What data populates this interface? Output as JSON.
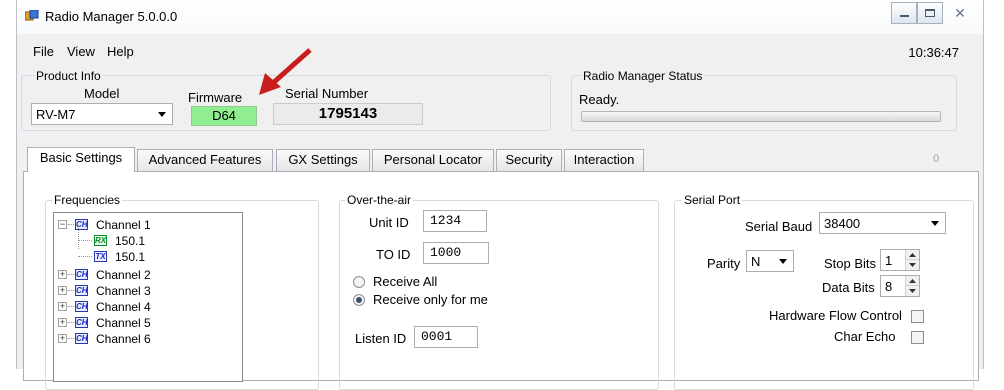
{
  "app": {
    "title": "Radio Manager  5.0.0.0"
  },
  "menu": {
    "file": "File",
    "view": "View",
    "help": "Help"
  },
  "clock": "10:36:47",
  "product_info": {
    "label": "Product Info",
    "model_label": "Model",
    "model_value": "RV-M7",
    "firmware_label": "Firmware",
    "firmware_value": "D64",
    "serial_label": "Serial Number",
    "serial_value": "1795143"
  },
  "status": {
    "label": "Radio Manager Status",
    "text": "Ready.",
    "progress": 0
  },
  "tabs": [
    "Basic Settings",
    "Advanced Features",
    "GX Settings",
    "Personal Locator",
    "Security",
    "Interaction"
  ],
  "tab_counter": "0",
  "frequencies": {
    "label": "Frequencies",
    "channels": [
      {
        "label": "Channel 1",
        "expanded": true,
        "rx": "150.1",
        "tx": "150.1"
      },
      {
        "label": "Channel 2"
      },
      {
        "label": "Channel 3"
      },
      {
        "label": "Channel 4"
      },
      {
        "label": "Channel 5"
      },
      {
        "label": "Channel 6"
      }
    ],
    "icons": {
      "ch": "CH",
      "rx": "RX",
      "tx": "TX"
    }
  },
  "ota": {
    "label": "Over-the-air",
    "unit_id_label": "Unit ID",
    "unit_id_value": "1234",
    "to_id_label": "TO ID",
    "to_id_value": "1000",
    "receive_all_label": "Receive All",
    "receive_only_label": "Receive only  for me",
    "listen_id_label": "Listen ID",
    "listen_id_value": "0001"
  },
  "serial_port": {
    "label": "Serial Port",
    "baud_label": "Serial Baud",
    "baud_value": "38400",
    "parity_label": "Parity",
    "parity_value": "N",
    "stop_bits_label": "Stop Bits",
    "stop_bits_value": "1",
    "data_bits_label": "Data Bits",
    "data_bits_value": "8",
    "hw_flow_label": "Hardware Flow Control",
    "char_echo_label": "Char Echo"
  },
  "colors": {
    "firmware_bg": "#90ee90",
    "arrow": "#d42020"
  }
}
